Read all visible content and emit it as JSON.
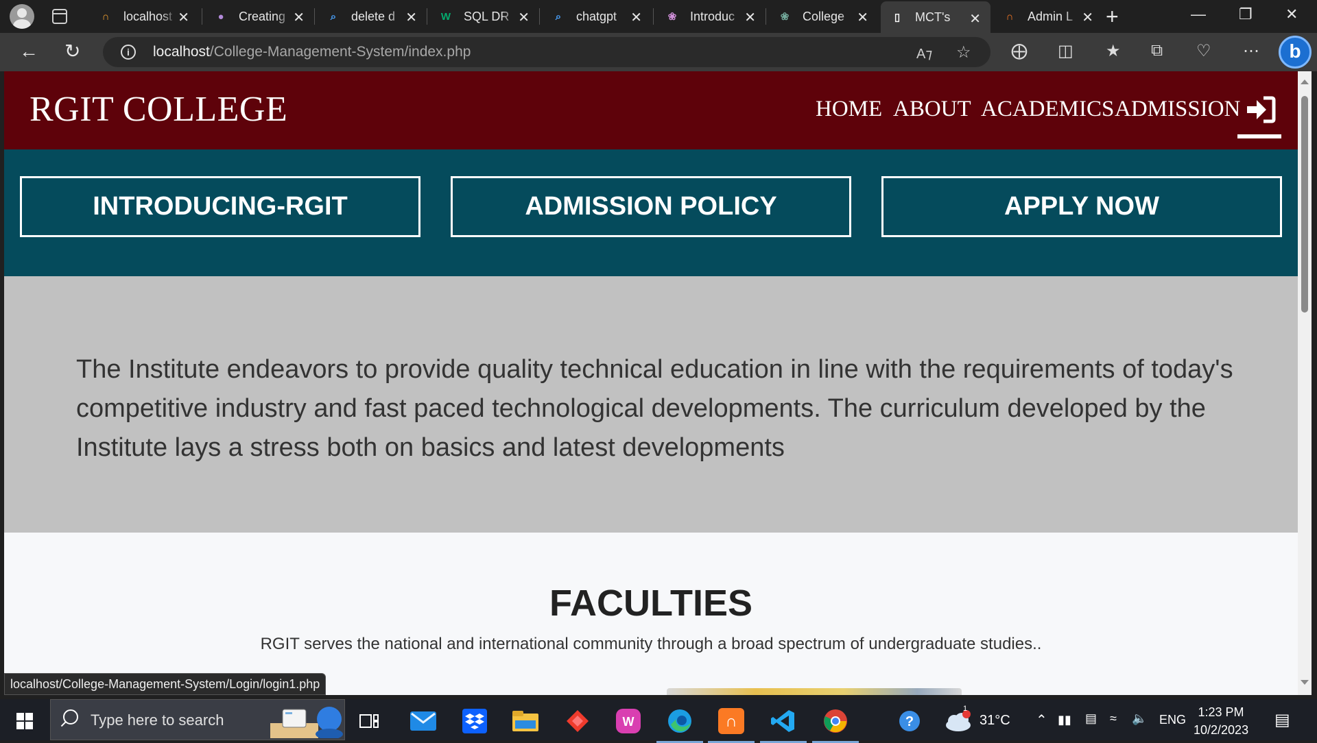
{
  "browser": {
    "tabs": [
      {
        "title": "localhost",
        "favicon": "phpmyadmin-icon",
        "color": "#f0a030"
      },
      {
        "title": "Creating",
        "favicon": "avatar-icon",
        "color": "#b28ad9"
      },
      {
        "title": "delete d",
        "favicon": "search-icon",
        "color": "#4aa3ff"
      },
      {
        "title": "SQL DR",
        "favicon": "w3schools-icon",
        "color": "#04aa6d"
      },
      {
        "title": "chatgpt",
        "favicon": "search-icon",
        "color": "#4aa3ff"
      },
      {
        "title": "Introduc",
        "favicon": "openai-icon",
        "color": "#cf8fd8"
      },
      {
        "title": "College",
        "favicon": "openai-icon",
        "color": "#74aa9c"
      },
      {
        "title": "MCT's",
        "favicon": "page-icon",
        "color": "#ffffff"
      },
      {
        "title": "Admin L",
        "favicon": "xampp-icon",
        "color": "#fb7a24"
      }
    ],
    "active_tab_index": 7,
    "url_host": "localhost",
    "url_path": "/College-Management-System/index.php",
    "status_url": "localhost/College-Management-System/Login/login1.php"
  },
  "site": {
    "brand": "RGIT COLLEGE",
    "nav": [
      "HOME",
      "ABOUT",
      "ACADEMICS",
      "ADMISSION"
    ],
    "cta_buttons": [
      "INTRODUCING-RGIT",
      "ADMISSION POLICY",
      "APPLY NOW"
    ],
    "intro_text": "The Institute endeavors to provide quality technical education in line with the requirements of today's competitive industry and fast paced technological developments. The curriculum developed by the Institute lays a stress both on basics and latest developments",
    "faculties_title": "FACULTIES",
    "faculties_subtitle": "RGIT serves the national and international community through a broad spectrum of undergraduate studies..",
    "colors": {
      "header": "#5e020a",
      "cta_band": "#054b5c",
      "intro_band": "#c1c1c1"
    }
  },
  "taskbar": {
    "search_placeholder": "Type here to search",
    "weather_temp": "31°C",
    "weather_badge": "1",
    "language": "ENG",
    "time": "1:23 PM",
    "date": "10/2/2023"
  }
}
